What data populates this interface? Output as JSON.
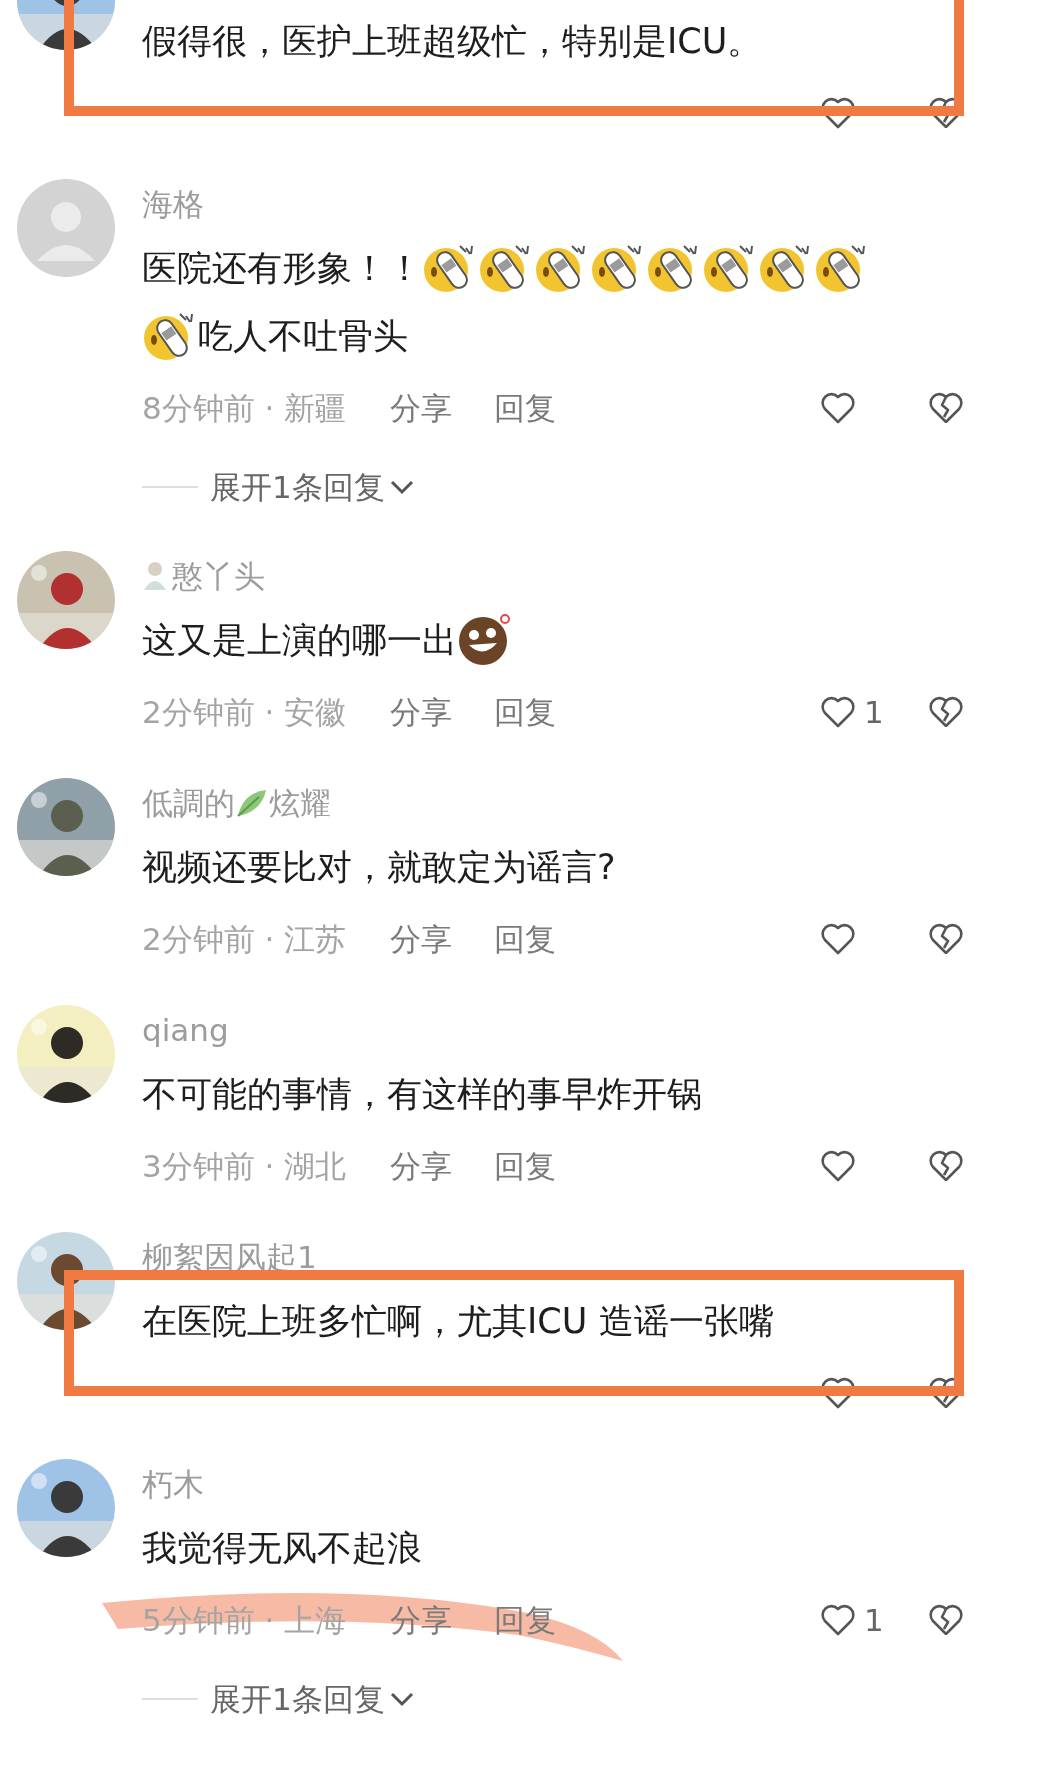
{
  "comments": [
    {
      "avatar": {
        "kind": "picture"
      },
      "text": [
        {
          "kind": "text",
          "text": "假得很，医护上班超级忙，特别是ICU。"
        }
      ],
      "boxed": true,
      "underlined": false
    },
    {
      "avatar": {
        "kind": "default"
      },
      "name": [
        {
          "kind": "text",
          "text": "海格"
        }
      ],
      "text": [
        {
          "kind": "text",
          "text": "医院还有形象！！"
        },
        {
          "kind": "slipper"
        },
        {
          "kind": "slipper"
        },
        {
          "kind": "slipper"
        },
        {
          "kind": "slipper"
        },
        {
          "kind": "slipper"
        },
        {
          "kind": "slipper"
        },
        {
          "kind": "slipper"
        },
        {
          "kind": "slipper"
        },
        {
          "kind": "slipper"
        },
        {
          "kind": "text",
          "text": "吃人不吐骨头"
        }
      ],
      "meta": "8分钟前 · 新疆",
      "share": "分享",
      "reply": "回复",
      "expand": "展开1条回复",
      "boxed": false,
      "underlined": false
    },
    {
      "avatar": {
        "kind": "picture"
      },
      "name": [
        {
          "kind": "figure"
        },
        {
          "kind": "text",
          "text": "憨丫头"
        }
      ],
      "text": [
        {
          "kind": "text",
          "text": "这又是上演的哪一出"
        },
        {
          "kind": "grin"
        }
      ],
      "meta": "2分钟前 · 安徽",
      "share": "分享",
      "reply": "回复",
      "likes": "1",
      "boxed": false,
      "underlined": false
    },
    {
      "avatar": {
        "kind": "picture"
      },
      "name": [
        {
          "kind": "text",
          "text": "低調的"
        },
        {
          "kind": "leaf"
        },
        {
          "kind": "text",
          "text": "炫耀"
        }
      ],
      "text": [
        {
          "kind": "text",
          "text": "视频还要比对，就敢定为谣言?"
        }
      ],
      "meta": "2分钟前 · 江苏",
      "share": "分享",
      "reply": "回复",
      "boxed": false,
      "underlined": false
    },
    {
      "avatar": {
        "kind": "picture"
      },
      "name": [
        {
          "kind": "text",
          "text": "qiang"
        }
      ],
      "text": [
        {
          "kind": "text",
          "text": "不可能的事情，有这样的事早炸开锅"
        }
      ],
      "meta": "3分钟前 · 湖北",
      "share": "分享",
      "reply": "回复",
      "boxed": false,
      "underlined": false
    },
    {
      "avatar": {
        "kind": "picture"
      },
      "name": [
        {
          "kind": "text",
          "text": "柳絮因风起1"
        }
      ],
      "text": [
        {
          "kind": "text",
          "text": "在医院上班多忙啊，尤其ICU 造谣一张嘴"
        }
      ],
      "boxed": true,
      "underlined": false
    },
    {
      "avatar": {
        "kind": "picture"
      },
      "name": [
        {
          "kind": "text",
          "text": "朽木"
        }
      ],
      "text": [
        {
          "kind": "text",
          "text": "我觉得无风不起浪"
        }
      ],
      "meta": "5分钟前 · 上海",
      "share": "分享",
      "reply": "回复",
      "likes": "1",
      "expand": "展开1条回复",
      "boxed": false,
      "underlined": true
    }
  ]
}
